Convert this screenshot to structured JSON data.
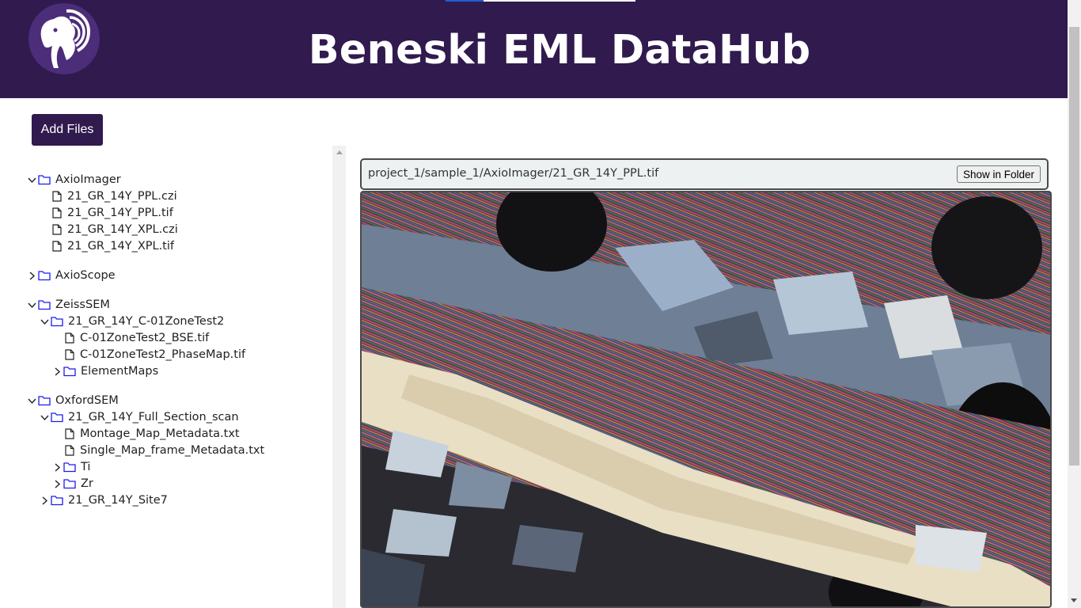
{
  "header": {
    "title": "Beneski EML DataHub",
    "logo_icon": "elephant-logo-icon",
    "bg_color": "#301a4e"
  },
  "toolbar": {
    "add_files_label": "Add Files"
  },
  "tree": [
    {
      "label": "AxioImager",
      "type": "folder",
      "expanded": true,
      "depth": 0
    },
    {
      "label": "21_GR_14Y_PPL.czi",
      "type": "file",
      "depth": 1
    },
    {
      "label": "21_GR_14Y_PPL.tif",
      "type": "file",
      "depth": 1
    },
    {
      "label": "21_GR_14Y_XPL.czi",
      "type": "file",
      "depth": 1
    },
    {
      "label": "21_GR_14Y_XPL.tif",
      "type": "file",
      "depth": 1
    },
    {
      "label": "AxioScope",
      "type": "folder",
      "expanded": false,
      "depth": 0
    },
    {
      "label": "ZeissSEM",
      "type": "folder",
      "expanded": true,
      "depth": 0
    },
    {
      "label": "21_GR_14Y_C-01ZoneTest2",
      "type": "folder",
      "expanded": true,
      "depth": 1
    },
    {
      "label": "C-01ZoneTest2_BSE.tif",
      "type": "file",
      "depth": 2
    },
    {
      "label": "C-01ZoneTest2_PhaseMap.tif",
      "type": "file",
      "depth": 2
    },
    {
      "label": "ElementMaps",
      "type": "folder",
      "expanded": false,
      "depth": 2
    },
    {
      "label": "OxfordSEM",
      "type": "folder",
      "expanded": true,
      "depth": 0
    },
    {
      "label": "21_GR_14Y_Full_Section_scan",
      "type": "folder",
      "expanded": true,
      "depth": 1
    },
    {
      "label": "Montage_Map_Metadata.txt",
      "type": "file",
      "depth": 2
    },
    {
      "label": "Single_Map_frame_Metadata.txt",
      "type": "file",
      "depth": 2
    },
    {
      "label": "Ti",
      "type": "folder",
      "expanded": false,
      "depth": 2
    },
    {
      "label": "Zr",
      "type": "folder",
      "expanded": false,
      "depth": 2
    },
    {
      "label": "21_GR_14Y_Site7",
      "type": "folder",
      "expanded": false,
      "depth": 1
    }
  ],
  "viewer": {
    "path": "project_1/sample_1/AxioImager/21_GR_14Y_PPL.tif",
    "show_in_folder_label": "Show in Folder"
  }
}
